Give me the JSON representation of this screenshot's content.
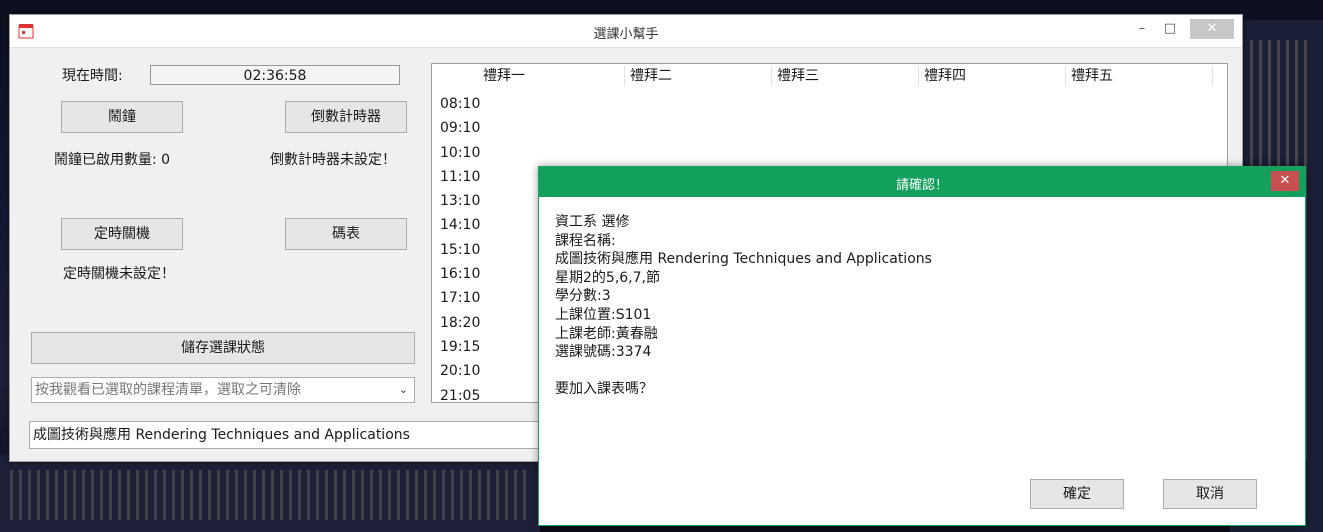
{
  "window": {
    "title": "選課小幫手",
    "minimize_glyph": "–",
    "maximize_glyph": "□",
    "close_glyph": "✕"
  },
  "clock": {
    "label": "現在時間:",
    "value": "02:36:58"
  },
  "buttons": {
    "alarm": "鬧鐘",
    "countdown": "倒數計時器",
    "shutdown": "定時關機",
    "stopwatch": "碼表",
    "save_state": "儲存選課狀態"
  },
  "status": {
    "alarm_count": "鬧鐘已啟用數量: 0",
    "countdown": "倒數計時器未設定！",
    "shutdown": "定時關機未設定！"
  },
  "selected_list": {
    "placeholder": "按我觀看已選取的課程清單，選取之可清除"
  },
  "current_course": "成圖技術與應用  Rendering Techniques and Applications",
  "schedule": {
    "days": [
      "禮拜一",
      "禮拜二",
      "禮拜三",
      "禮拜四",
      "禮拜五"
    ],
    "times": [
      "08:10",
      "09:10",
      "10:10",
      "11:10",
      "13:10",
      "14:10",
      "15:10",
      "16:10",
      "17:10",
      "18:20",
      "19:15",
      "20:10",
      "21:05"
    ]
  },
  "dialog": {
    "title": "請確認！",
    "lines": [
      "資工系 選修",
      "課程名稱:",
      "成圖技術與應用  Rendering Techniques and Applications",
      "星期2的5,6,7,節",
      "學分數:3",
      "上課位置:S101",
      "上課老師:黃春融",
      "選課號碼:3374",
      "",
      "要加入課表嗎？"
    ],
    "confirm": "確定",
    "cancel": "取消",
    "close_glyph": "✕"
  },
  "colors": {
    "dialog_accent": "#12a05c",
    "close_red": "#c75050"
  }
}
